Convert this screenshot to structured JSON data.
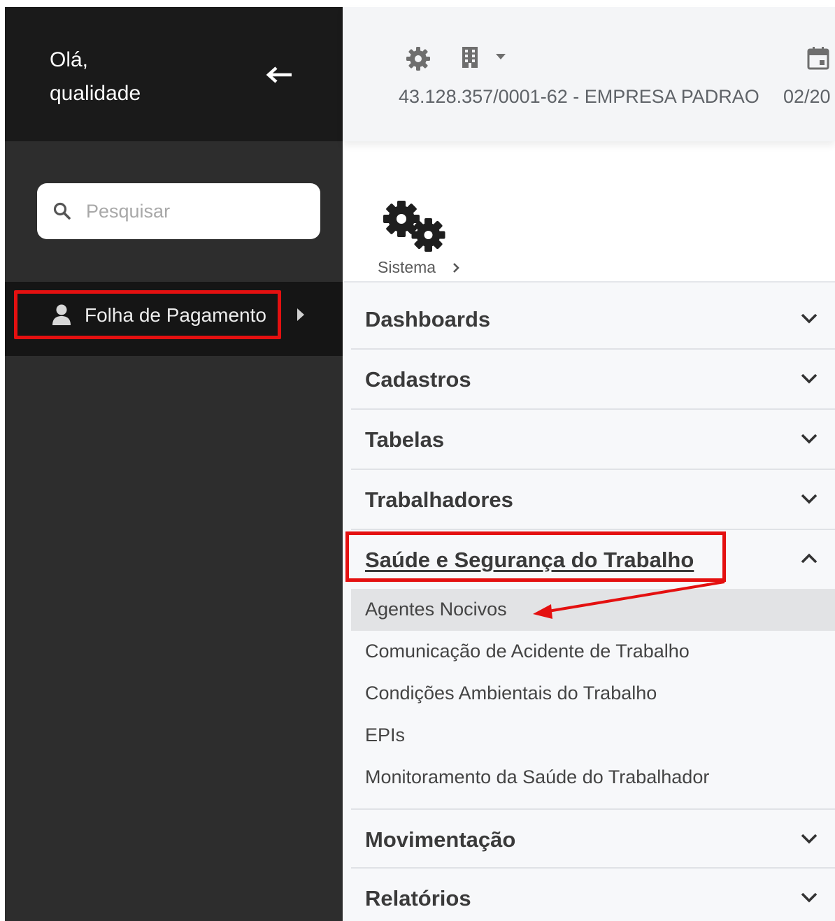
{
  "sidebar": {
    "greeting_line1": "Olá,",
    "greeting_line2": "qualidade",
    "search": {
      "placeholder": "Pesquisar",
      "value": ""
    },
    "module": {
      "label": "Folha de Pagamento"
    }
  },
  "header": {
    "company": "43.128.357/0001-62 - EMPRESA PADRAO",
    "period": "02/20"
  },
  "breadcrumb": {
    "label": "Sistema"
  },
  "menu": {
    "sections": [
      {
        "label": "Dashboards",
        "expanded": false
      },
      {
        "label": "Cadastros",
        "expanded": false
      },
      {
        "label": "Tabelas",
        "expanded": false
      },
      {
        "label": "Trabalhadores",
        "expanded": false
      },
      {
        "label": "Saúde e Segurança do Trabalho",
        "expanded": true,
        "items": [
          {
            "label": "Agentes Nocivos",
            "active": true
          },
          {
            "label": "Comunicação de Acidente de Trabalho"
          },
          {
            "label": "Condições Ambientais do Trabalho"
          },
          {
            "label": "EPIs"
          },
          {
            "label": "Monitoramento da Saúde do Trabalhador"
          }
        ]
      },
      {
        "label": "Movimentação",
        "expanded": false
      },
      {
        "label": "Relatórios",
        "expanded": false
      }
    ]
  },
  "colors": {
    "sidebar_bg": "#2d2d2d",
    "sidebar_header_bg": "#1a1a1a",
    "annotation_red": "#e41010",
    "active_item_bg": "#e2e3e5"
  },
  "icons": [
    "arrow-left-icon",
    "search-icon",
    "user-icon",
    "caret-right-icon",
    "gear-icon",
    "building-icon",
    "caret-down-icon",
    "calendar-icon",
    "gears-icon",
    "chevron-right-icon",
    "chevron-down-icon",
    "chevron-up-icon"
  ]
}
